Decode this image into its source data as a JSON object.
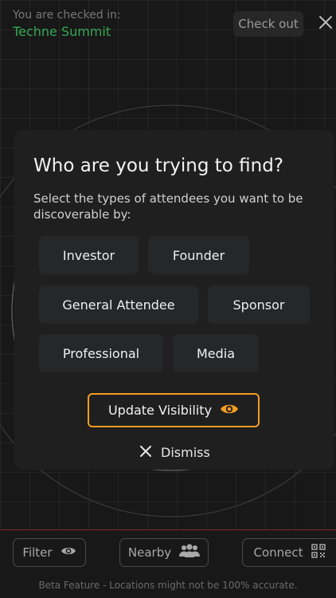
{
  "header": {
    "checked_in_label": "You are checked in:",
    "event_name": "Techne Summit",
    "checkout_label": "Check out"
  },
  "modal": {
    "title": "Who are you trying to find?",
    "description": "Select the types of attendees you want to be discoverable by:",
    "options": [
      "Investor",
      "Founder",
      "General Attendee",
      "Sponsor",
      "Professional",
      "Media"
    ],
    "update_label": "Update Visibility",
    "dismiss_label": "Dismiss"
  },
  "toolbar": {
    "filter_label": "Filter",
    "nearby_label": "Nearby",
    "connect_label": "Connect"
  },
  "footer_note": "Beta Feature - Locations might not be 100% accurate.",
  "colors": {
    "accent_orange": "#f39c24",
    "event_green": "#34a853",
    "modal_bg": "#1f1f1f",
    "chip_bg": "#252728"
  }
}
